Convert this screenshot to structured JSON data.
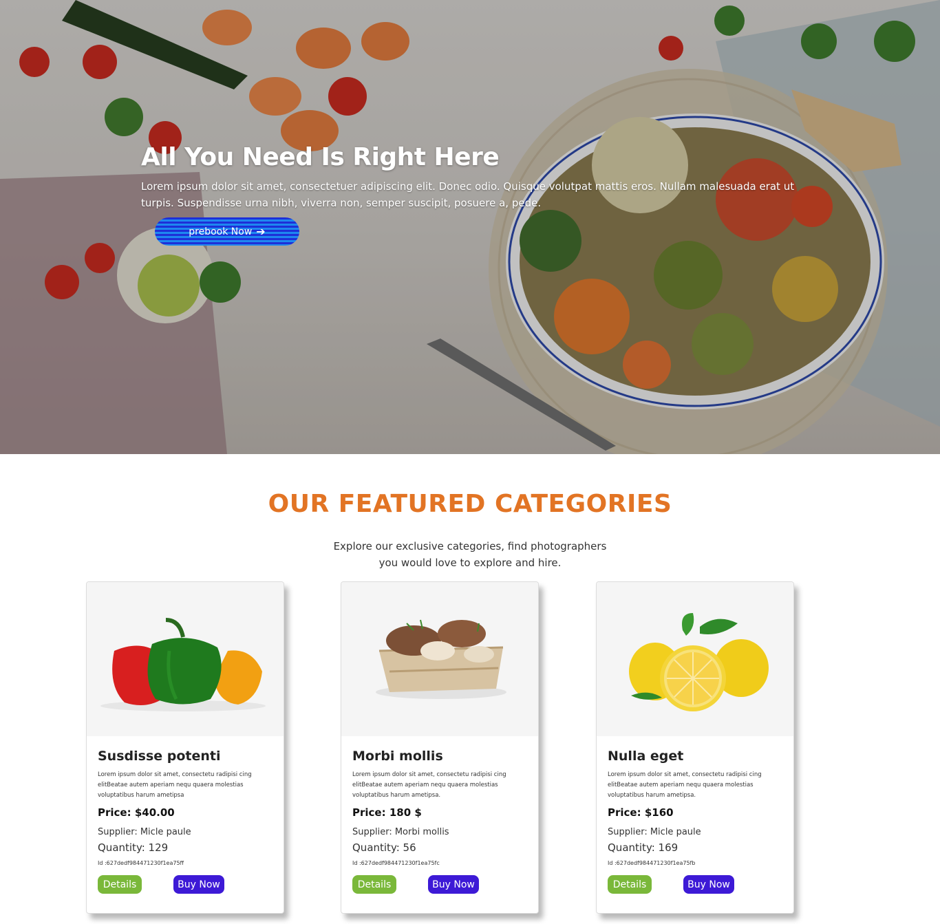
{
  "hero": {
    "title": "All You Need Is Right Here",
    "text": "Lorem ipsum dolor sit amet, consectetuer adipiscing elit. Donec odio. Quisque volutpat mattis eros. Nullam malesuada erat ut turpis. Suspendisse urna nibh, viverra non, semper suscipit, posuere a, pede.",
    "button_label": "prebook Now",
    "button_icon": "arrow-right-icon"
  },
  "featured": {
    "title": "OUR FEATURED CATEGORIES",
    "subtitle": "Explore our exclusive categories, find photographers you would love to explore and hire."
  },
  "products": [
    {
      "name": "Susdisse potenti",
      "description": "Lorem ipsum dolor sit amet, consectetu radipisi cing elitBeatae autem aperiam nequ quaera molestias voluptatibus harum ametipsa",
      "price": "Price: $40.00",
      "supplier": "Supplier: Micle paule",
      "quantity": "Quantity: 129",
      "id": "Id :627dedf984471230f1ea75ff",
      "image": "bell-peppers",
      "details_label": "Details",
      "buy_label": "Buy Now"
    },
    {
      "name": "Morbi mollis",
      "description": "Lorem ipsum dolor sit amet, consectetu radipisi cing elitBeatae autem aperiam nequ quaera molestias voluptatibus harum ametipsa.",
      "price": "Price: 180 $",
      "supplier": "Supplier: Morbi mollis",
      "quantity": "Quantity: 56",
      "id": "Id :627dedf984471230f1ea75fc",
      "image": "mushroom-basket",
      "details_label": "Details",
      "buy_label": "Buy Now"
    },
    {
      "name": "Nulla eget",
      "description": "Lorem ipsum dolor sit amet, consectetu radipisi cing elitBeatae autem aperiam nequ quaera molestias voluptatibus harum ametipsa.",
      "price": "Price: $160",
      "supplier": "Supplier: Micle paule",
      "quantity": "Quantity: 169",
      "id": "Id :627dedf984471230f1ea75fb",
      "image": "lemons",
      "details_label": "Details",
      "buy_label": "Buy Now"
    }
  ],
  "colors": {
    "accent_orange": "#e27424",
    "details_green": "#7ab83a",
    "buy_purple": "#3d1ad6",
    "hero_button_blue": "#1e88f0"
  }
}
